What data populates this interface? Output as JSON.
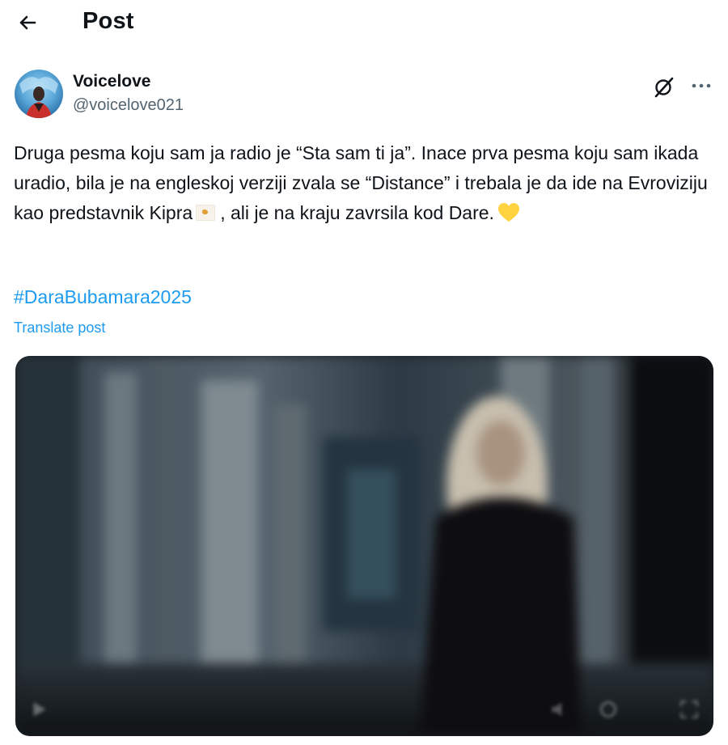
{
  "header": {
    "title": "Post",
    "back_icon": "arrow-left-icon"
  },
  "author": {
    "display_name": "Voicelove",
    "handle": "@voicelove021",
    "avatar_icon": "avatar-photo"
  },
  "actions": {
    "grok_icon": "grok-icon",
    "more_icon": "more-horizontal-icon"
  },
  "post": {
    "text_part1": "Druga pesma koju sam ja radio je “Sta sam ti ja”. Inace prva pesma koju sam ikada uradio, bila je na engleskoj verziji zvala se “Distance” i trebala je da ide na Evroviziju kao predstavnik Kipra",
    "flag_icon": "cyprus-flag-emoji",
    "text_part2": ", ali je na kraju zavrsila kod Dare.",
    "heart_icon": "yellow-heart-emoji",
    "hashtag": "#DaraBubamara2025",
    "translate_label": "Translate post"
  },
  "media": {
    "type": "video",
    "play_icon": "play-icon",
    "volume_icon": "volume-icon",
    "settings_icon": "settings-icon",
    "fullscreen_icon": "fullscreen-icon"
  },
  "colors": {
    "link": "#1d9bf0",
    "text": "#0f1419",
    "secondary_text": "#536471",
    "heart": "#ffd23f"
  }
}
